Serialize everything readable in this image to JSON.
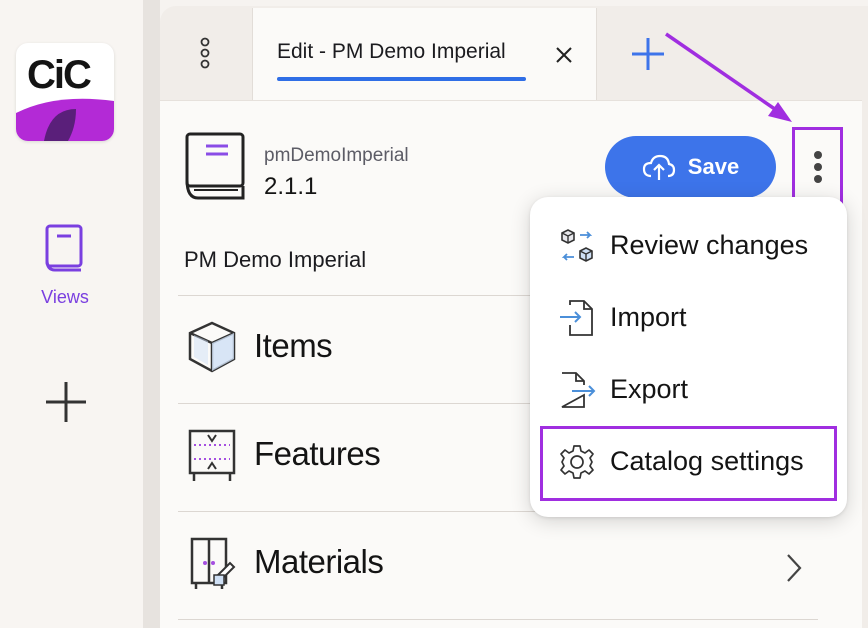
{
  "rail": {
    "logo_text": "CiC",
    "views_label": "Views"
  },
  "tab": {
    "title": "Edit - PM Demo Imperial"
  },
  "catalog": {
    "id": "pmDemoImperial",
    "version": "2.1.1",
    "name": "PM Demo Imperial"
  },
  "toolbar": {
    "save_label": "Save"
  },
  "sections": [
    {
      "label": "Items",
      "icon": "cube-icon"
    },
    {
      "label": "Features",
      "icon": "features-icon"
    },
    {
      "label": "Materials",
      "icon": "materials-icon"
    }
  ],
  "menu": {
    "items": [
      {
        "label": "Review changes",
        "icon": "review-changes-icon"
      },
      {
        "label": "Import",
        "icon": "import-icon"
      },
      {
        "label": "Export",
        "icon": "export-icon"
      },
      {
        "label": "Catalog settings",
        "icon": "gear-icon"
      }
    ]
  },
  "colors": {
    "accent": "#3d74ea",
    "annotation": "#a02ee0",
    "brand_purple": "#b32ad6",
    "views_purple": "#7a3fe0"
  }
}
